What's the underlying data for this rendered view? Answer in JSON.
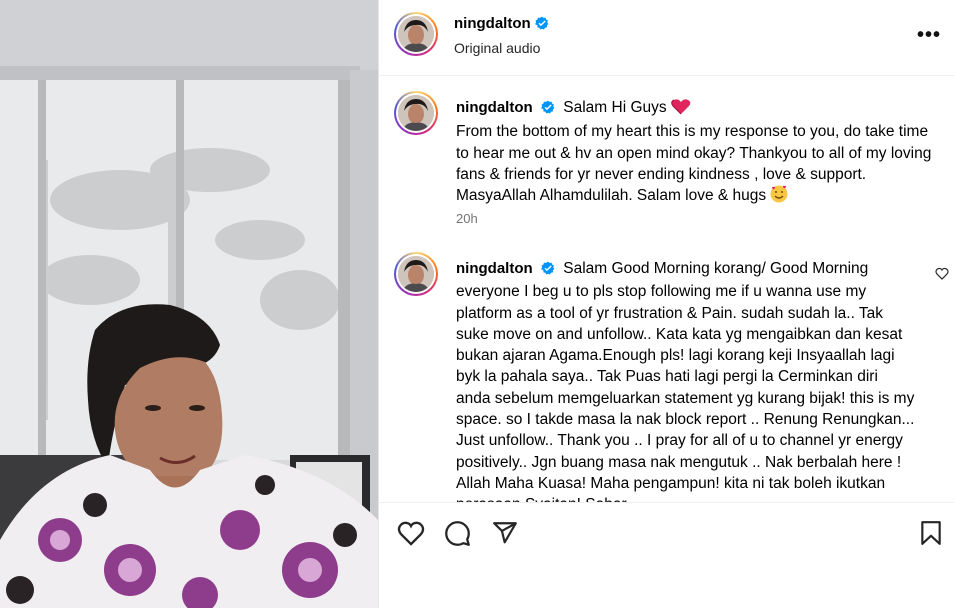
{
  "header": {
    "username": "ningdalton",
    "subtitle": "Original audio",
    "more_icon": "more-horizontal-icon"
  },
  "comments": [
    {
      "username": "ningdalton",
      "text": "Salam Hi Guys",
      "text_rest": "From the bottom of my heart this is my response to you, do take time to hear me out & hv an open mind okay? Thankyou to all of my loving fans & friends for yr never ending kindness , love & support. MasyaAllah Alhamdulilah. Salam love & hugs",
      "time": "20h",
      "emoji_1": "red-heart",
      "emoji_2": "smiling-face-with-hearts"
    },
    {
      "username": "ningdalton",
      "text": "Salam Good Morning korang/ Good Morning everyone I beg u to pls stop following me if u wanna use my platform as a tool of yr frustration & Pain. sudah sudah la.. Tak suke move on and unfollow.. Kata kata yg mengaibkan dan kesat bukan ajaran Agama.Enough pls! lagi korang keji Insyaallah lagi byk la pahala saya.. Tak Puas hati lagi pergi la Cerminkan diri anda sebelum memgeluarkan statement yg kurang bijak! this is my space. so I takde masa la nak block report .. Renung Renungkan... Just unfollow.. Thank you .. I pray for all of u to channel yr energy positively.. Jgn buang masa nak mengutuk .. Nak berbalah here ! Allah Maha Kuasa! Maha pengampun! kita ni tak boleh ikutkan perasaan Syaitan! Sabar"
    }
  ],
  "actions": {
    "like_icon": "heart-outline-icon",
    "comment_icon": "comment-icon",
    "share_icon": "paper-plane-icon",
    "save_icon": "bookmark-icon"
  },
  "colors": {
    "verified": "#0095f6",
    "muted": "#737373",
    "divider": "#efefef"
  }
}
